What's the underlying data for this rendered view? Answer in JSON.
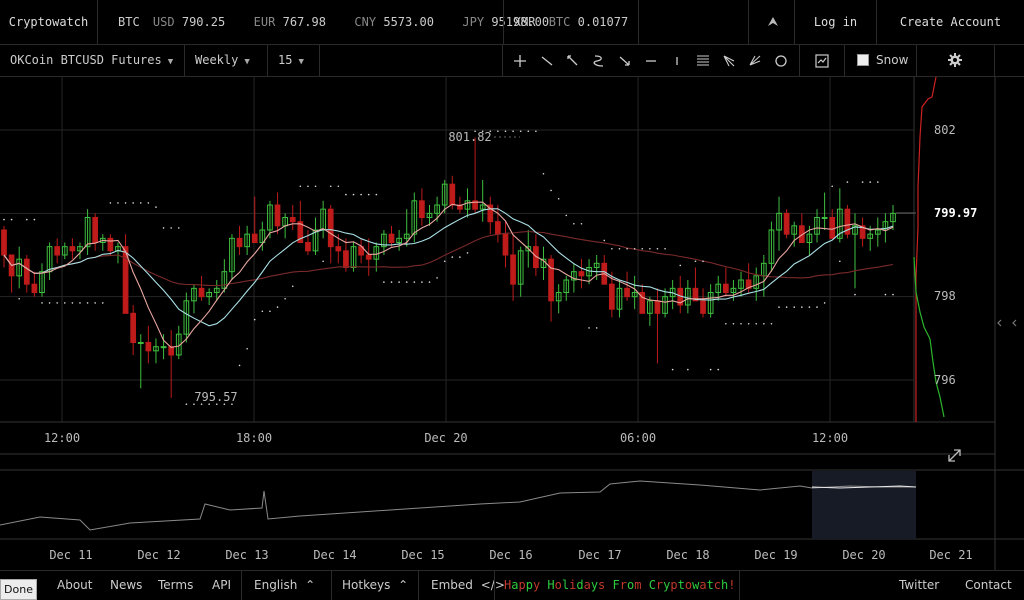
{
  "header": {
    "brand": "Cryptowatch",
    "tickers": [
      {
        "sym": "BTC",
        "pair": "USD",
        "value": "790.25"
      },
      {
        "sym": "",
        "pair": "EUR",
        "value": "767.98"
      },
      {
        "sym": "",
        "pair": "CNY",
        "value": "5573.00"
      },
      {
        "sym": "",
        "pair": "JPY",
        "value": "95198.00"
      }
    ],
    "xmr": {
      "sym": "XMR",
      "pair": "BTC",
      "value": "0.01077"
    },
    "alert_icon": "rocket-icon",
    "login_label": "Log in",
    "create_account_label": "Create Account"
  },
  "toolbar": {
    "market": "OKCoin BTCUSD Futures",
    "contract": "Weekly",
    "interval": "15",
    "draw_tools": [
      "crosshair-icon",
      "trendline-icon",
      "ray-icon",
      "curve-icon",
      "arrow-icon",
      "horizontal-line-icon",
      "vertical-line-icon",
      "fibonacci-icon",
      "pitchfork-icon",
      "fan-icon",
      "circle-icon"
    ],
    "snow_label": "Snow",
    "snow_checked": false
  },
  "chart_data": {
    "type": "candlestick",
    "market": "OKCoin BTCUSD Futures Weekly",
    "interval_minutes": 15,
    "price_axis": {
      "ticks": [
        "802",
        "799.97",
        "798",
        "796"
      ],
      "current_price": "799.97"
    },
    "time_axis": {
      "ticks": [
        "12:00",
        "18:00",
        "Dec 20",
        "06:00",
        "12:00"
      ]
    },
    "annotations": {
      "high_label": "801.82",
      "low_label": "795.57"
    },
    "candles_ohlc": [
      [
        799.6,
        799.7,
        798.7,
        799.0
      ],
      [
        799.0,
        799.0,
        798.1,
        798.5
      ],
      [
        798.5,
        799.2,
        798.2,
        798.9
      ],
      [
        798.9,
        799.0,
        798.1,
        798.3
      ],
      [
        798.3,
        798.6,
        798.0,
        798.1
      ],
      [
        798.1,
        798.8,
        798.0,
        798.6
      ],
      [
        798.6,
        799.3,
        798.4,
        799.2
      ],
      [
        799.2,
        799.4,
        798.8,
        799.0
      ],
      [
        799.0,
        799.3,
        798.9,
        799.2
      ],
      [
        799.2,
        799.4,
        798.9,
        799.1
      ],
      [
        799.1,
        799.3,
        798.9,
        799.2
      ],
      [
        799.2,
        800.1,
        799.0,
        799.9
      ],
      [
        799.9,
        800.0,
        799.1,
        799.3
      ],
      [
        799.3,
        799.5,
        799.1,
        799.4
      ],
      [
        799.4,
        799.5,
        799.0,
        799.1
      ],
      [
        799.1,
        799.3,
        798.8,
        799.2
      ],
      [
        799.2,
        799.5,
        797.8,
        797.6
      ],
      [
        797.6,
        797.8,
        796.6,
        796.9
      ],
      [
        796.9,
        797.1,
        795.8,
        796.9
      ],
      [
        796.9,
        797.3,
        796.4,
        796.7
      ],
      [
        796.7,
        797.0,
        796.4,
        796.8
      ],
      [
        796.8,
        797.1,
        796.5,
        796.8
      ],
      [
        796.8,
        797.2,
        795.57,
        796.6
      ],
      [
        796.6,
        797.3,
        796.5,
        797.1
      ],
      [
        797.1,
        798.1,
        796.9,
        797.9
      ],
      [
        797.9,
        798.3,
        797.6,
        798.2
      ],
      [
        798.2,
        798.5,
        797.9,
        798.0
      ],
      [
        798.0,
        798.2,
        797.8,
        798.1
      ],
      [
        798.1,
        798.4,
        797.9,
        798.2
      ],
      [
        798.2,
        798.9,
        798.1,
        798.6
      ],
      [
        798.6,
        799.5,
        798.4,
        799.4
      ],
      [
        799.4,
        799.7,
        799.0,
        799.2
      ],
      [
        799.2,
        799.7,
        799.0,
        799.5
      ],
      [
        799.5,
        800.4,
        799.3,
        799.3
      ],
      [
        799.3,
        799.8,
        799.1,
        799.6
      ],
      [
        799.6,
        800.3,
        799.4,
        800.2
      ],
      [
        800.2,
        800.5,
        799.5,
        799.7
      ],
      [
        799.7,
        800.0,
        799.4,
        799.9
      ],
      [
        799.9,
        800.2,
        799.6,
        799.8
      ],
      [
        799.8,
        800.3,
        799.6,
        799.3
      ],
      [
        799.3,
        799.6,
        799.0,
        799.1
      ],
      [
        799.1,
        799.9,
        799.0,
        799.6
      ],
      [
        799.6,
        800.3,
        799.4,
        800.1
      ],
      [
        800.1,
        800.2,
        798.8,
        799.2
      ],
      [
        799.2,
        799.5,
        798.8,
        799.1
      ],
      [
        799.1,
        799.4,
        798.6,
        798.7
      ],
      [
        798.7,
        799.3,
        798.6,
        799.2
      ],
      [
        799.2,
        799.4,
        798.8,
        799.0
      ],
      [
        799.0,
        799.4,
        798.5,
        798.9
      ],
      [
        798.9,
        799.3,
        798.6,
        799.2
      ],
      [
        799.2,
        799.6,
        799.0,
        799.5
      ],
      [
        799.5,
        799.7,
        799.2,
        799.3
      ],
      [
        799.3,
        799.6,
        799.1,
        799.4
      ],
      [
        799.4,
        800.1,
        799.2,
        799.5
      ],
      [
        799.5,
        800.5,
        799.3,
        800.3
      ],
      [
        800.3,
        800.6,
        799.7,
        799.9
      ],
      [
        799.9,
        800.2,
        799.7,
        800.0
      ],
      [
        800.0,
        800.4,
        799.8,
        800.2
      ],
      [
        800.2,
        800.8,
        800.0,
        800.7
      ],
      [
        800.7,
        800.9,
        800.1,
        800.2
      ],
      [
        800.2,
        800.4,
        800.0,
        800.1
      ],
      [
        800.1,
        800.6,
        799.9,
        800.3
      ],
      [
        800.3,
        801.82,
        800.0,
        800.1
      ],
      [
        800.1,
        800.8,
        799.8,
        800.2
      ],
      [
        800.2,
        800.4,
        799.5,
        799.8
      ],
      [
        799.8,
        800.2,
        799.3,
        799.5
      ],
      [
        799.5,
        799.8,
        798.7,
        799.0
      ],
      [
        799.0,
        799.5,
        797.9,
        798.3
      ],
      [
        798.3,
        799.2,
        798.0,
        799.1
      ],
      [
        799.1,
        799.6,
        798.7,
        799.2
      ],
      [
        799.2,
        799.5,
        798.5,
        798.7
      ],
      [
        798.7,
        799.2,
        798.4,
        798.9
      ],
      [
        798.9,
        799.0,
        797.4,
        797.9
      ],
      [
        797.9,
        798.3,
        797.6,
        798.1
      ],
      [
        798.1,
        798.5,
        797.9,
        798.4
      ],
      [
        798.4,
        798.8,
        798.1,
        798.6
      ],
      [
        798.6,
        798.9,
        798.2,
        798.5
      ],
      [
        798.5,
        798.9,
        798.3,
        798.7
      ],
      [
        798.7,
        799.0,
        798.4,
        798.8
      ],
      [
        798.8,
        799.0,
        798.3,
        798.3
      ],
      [
        798.3,
        798.6,
        797.5,
        797.7
      ],
      [
        797.7,
        798.4,
        797.5,
        798.2
      ],
      [
        798.2,
        798.6,
        797.9,
        798.0
      ],
      [
        798.0,
        798.5,
        797.7,
        798.1
      ],
      [
        798.1,
        798.3,
        797.6,
        797.6
      ],
      [
        797.6,
        798.0,
        797.3,
        797.9
      ],
      [
        797.9,
        798.2,
        796.4,
        797.6
      ],
      [
        797.6,
        798.2,
        797.5,
        798.0
      ],
      [
        798.0,
        798.4,
        797.7,
        798.2
      ],
      [
        798.2,
        798.5,
        797.6,
        797.8
      ],
      [
        797.8,
        798.4,
        797.6,
        798.2
      ],
      [
        798.2,
        798.7,
        797.9,
        797.9
      ],
      [
        797.9,
        798.2,
        797.5,
        797.6
      ],
      [
        797.6,
        798.3,
        797.5,
        798.1
      ],
      [
        798.1,
        798.5,
        797.9,
        798.3
      ],
      [
        798.3,
        798.7,
        798.0,
        798.1
      ],
      [
        798.1,
        798.4,
        797.9,
        798.2
      ],
      [
        798.2,
        798.6,
        798.0,
        798.4
      ],
      [
        798.4,
        798.8,
        798.1,
        798.2
      ],
      [
        798.2,
        798.7,
        797.9,
        798.5
      ],
      [
        798.5,
        799.0,
        798.0,
        798.8
      ],
      [
        798.8,
        799.8,
        798.6,
        799.6
      ],
      [
        799.6,
        800.4,
        799.1,
        800.0
      ],
      [
        800.0,
        800.1,
        799.4,
        799.5
      ],
      [
        799.5,
        799.8,
        799.2,
        799.7
      ],
      [
        799.7,
        800.0,
        799.3,
        799.3
      ],
      [
        799.3,
        799.7,
        799.0,
        799.5
      ],
      [
        799.5,
        800.1,
        799.3,
        799.9
      ],
      [
        799.9,
        800.5,
        799.6,
        799.9
      ],
      [
        799.9,
        800.1,
        799.4,
        799.4
      ],
      [
        799.4,
        800.6,
        799.3,
        800.1
      ],
      [
        800.1,
        800.2,
        799.4,
        799.5
      ],
      [
        799.5,
        800.0,
        798.2,
        799.7
      ],
      [
        799.7,
        799.9,
        799.2,
        799.4
      ],
      [
        799.4,
        799.7,
        799.1,
        799.5
      ],
      [
        799.5,
        799.9,
        799.2,
        799.6
      ],
      [
        799.6,
        800.0,
        799.3,
        799.8
      ],
      [
        799.8,
        800.2,
        799.6,
        800.0
      ]
    ],
    "navigator": {
      "ticks": [
        "Dec 11",
        "Dec 12",
        "Dec 13",
        "Dec 14",
        "Dec 15",
        "Dec 16",
        "Dec 17",
        "Dec 18",
        "Dec 19",
        "Dec 20",
        "Dec 21"
      ]
    },
    "colors": {
      "up": "#3fbf3f",
      "down": "#bf1b1b",
      "ma_fast": "#e8a6a0",
      "ma_mid": "#a8e0e6",
      "ma_slow": "#7a2a2a",
      "grid": "#262626"
    }
  },
  "footer": {
    "done_label": "Done",
    "links": [
      "About",
      "News",
      "Terms",
      "API"
    ],
    "language": "English",
    "hotkeys": "Hotkeys",
    "embed": "Embed",
    "holiday_message": "Happy Holidays From Cryptowatch!",
    "twitter": "Twitter",
    "contact": "Contact"
  }
}
